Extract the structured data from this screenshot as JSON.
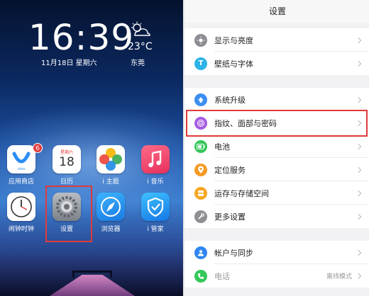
{
  "home": {
    "time": "16:39",
    "date": "11月18日  星期六",
    "temperature": "23°C",
    "city": "东莞",
    "apps": [
      {
        "label": "应用商店",
        "badge": "6"
      },
      {
        "label": "日历",
        "cal_weekday": "星期六",
        "cal_day": "18"
      },
      {
        "label": "i 主题"
      },
      {
        "label": "i 音乐"
      },
      {
        "label": "闹钟时钟"
      },
      {
        "label": "设置"
      },
      {
        "label": "浏览器"
      },
      {
        "label": "i 管家"
      }
    ],
    "colors": {
      "highlight": "#e03a3a"
    }
  },
  "settings": {
    "title": "设置",
    "items": [
      {
        "label": "显示与亮度",
        "icon": "brightness-icon",
        "color": "#8c8c94"
      },
      {
        "label": "壁纸与字体",
        "icon": "font-icon",
        "color": "#2db3e8"
      },
      {
        "label": "系统升级",
        "icon": "upgrade-icon",
        "color": "#3b8df0"
      },
      {
        "label": "指纹、面部与密码",
        "icon": "fingerprint-icon",
        "color": "#a45be0"
      },
      {
        "label": "电池",
        "icon": "battery-icon",
        "color": "#34c759"
      },
      {
        "label": "定位服务",
        "icon": "location-icon",
        "color": "#f59a23"
      },
      {
        "label": "运存与存储空间",
        "icon": "storage-icon",
        "color": "#f5a623"
      },
      {
        "label": "更多设置",
        "icon": "wrench-icon",
        "color": "#8e8e93"
      },
      {
        "label": "帐户与同步",
        "icon": "account-icon",
        "color": "#2f86f0"
      },
      {
        "label": "电话",
        "icon": "phone-icon",
        "color": "#34c759",
        "value": "离线模式"
      }
    ]
  }
}
